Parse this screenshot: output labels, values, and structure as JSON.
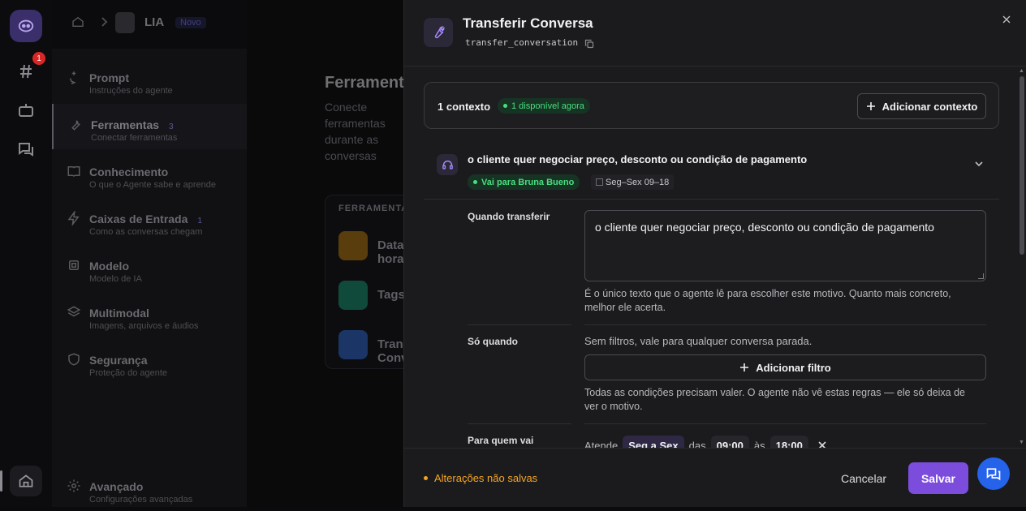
{
  "topbar": {
    "agent_name": "LIA",
    "status_badge": "Novo"
  },
  "rail": {
    "notifications_count": "1"
  },
  "sidebar": {
    "items": [
      {
        "title": "Prompt",
        "subtitle": "Instruções do agente",
        "count": ""
      },
      {
        "title": "Ferramentas",
        "subtitle": "Conectar ferramentas",
        "count": "3"
      },
      {
        "title": "Conhecimento",
        "subtitle": "O que o Agente sabe e aprende",
        "count": ""
      },
      {
        "title": "Caixas de Entrada",
        "subtitle": "Como as conversas chegam",
        "count": "1"
      },
      {
        "title": "Modelo",
        "subtitle": "Modelo de IA",
        "count": ""
      },
      {
        "title": "Multimodal",
        "subtitle": "Imagens, arquivos e áudios",
        "count": ""
      },
      {
        "title": "Segurança",
        "subtitle": "Proteção do agente",
        "count": ""
      }
    ],
    "footer_item": {
      "title": "Avançado",
      "subtitle": "Configurações avançadas"
    }
  },
  "main": {
    "title": "Ferramentas",
    "description": "Conecte ferramentas durante as conversas",
    "tools_header": "FERRAMENTAS",
    "tools": [
      {
        "label": "Data e hora",
        "color": "#f59e0b"
      },
      {
        "label": "Tags",
        "color": "#10b981"
      },
      {
        "label": "Transferir Conversa",
        "color": "#3b82f6"
      }
    ]
  },
  "panel": {
    "title": "Transferir Conversa",
    "code": "transfer_conversation",
    "context": {
      "count_label": "1 contexto",
      "available_label": "1 disponível agora",
      "add_button": "Adicionar contexto"
    },
    "rule": {
      "title": "o cliente quer negociar preço, desconto ou condição de pagamento",
      "destination": "Vai para Bruna Bueno",
      "schedule": "Seg–Sex 09–18"
    },
    "fields": {
      "when_label": "Quando transferir",
      "when_value": "o cliente quer negociar preço, desconto ou condição de pagamento",
      "when_help": "É o único texto que o agente lê para escolher este motivo. Quanto mais concreto, melhor ele acerta.",
      "only_when_label": "Só quando",
      "only_when_desc": "Sem filtros, vale para qualquer conversa parada.",
      "add_filter_button": "Adicionar filtro",
      "only_when_help": "Todas as condições precisam valer. O agente não vê estas regras — ele só deixa de ver o motivo.",
      "to_whom_label": "Para quem vai",
      "attends_text": "Atende",
      "days": "Seg a Sex",
      "from_text": "das",
      "start_time": "09:00",
      "to_text": "às",
      "end_time": "18:00"
    },
    "footer": {
      "unsaved": "Alterações não salvas",
      "cancel": "Cancelar",
      "save": "Salvar"
    }
  },
  "colors": {
    "accent": "#7c4ddc",
    "success": "#4ade80",
    "warning": "#f5a524",
    "fab": "#2563eb"
  }
}
